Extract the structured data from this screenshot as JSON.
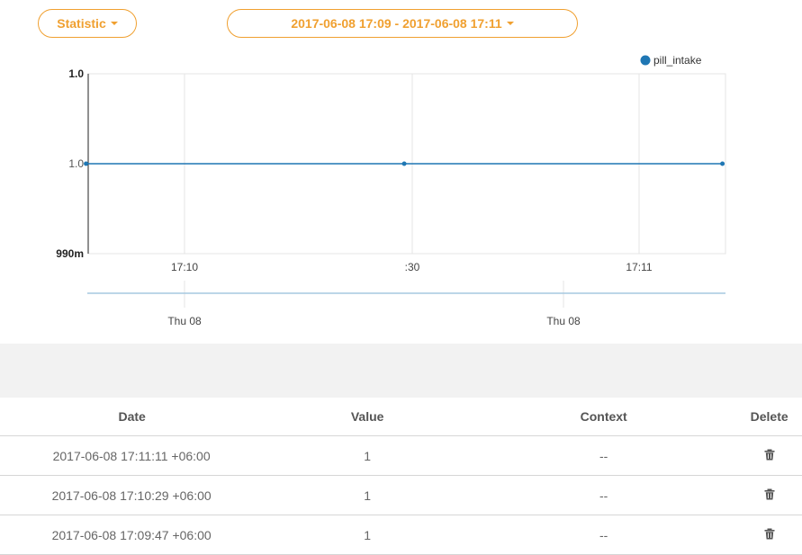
{
  "controls": {
    "statistic_label": "Statistic",
    "range_label": "2017-06-08 17:09 - 2017-06-08 17:11"
  },
  "chart_data": {
    "type": "line",
    "legend": {
      "label": "pill_intake",
      "placement": "top-right"
    },
    "series": [
      {
        "name": "pill_intake",
        "color": "#1f77b4",
        "x": [
          "2017-06-08 17:09:47",
          "2017-06-08 17:10:29",
          "2017-06-08 17:11:11"
        ],
        "values": [
          1,
          1,
          1
        ]
      }
    ],
    "y_ticks": [
      "1.0",
      "1.0",
      "990m"
    ],
    "x_ticks": [
      "17:10",
      ":30",
      "17:11"
    ],
    "navigator_ticks": [
      "Thu 08",
      "Thu 08"
    ],
    "grid": true
  },
  "table": {
    "headers": {
      "date": "Date",
      "value": "Value",
      "context": "Context",
      "delete": "Delete"
    },
    "rows": [
      {
        "date": "2017-06-08 17:11:11 +06:00",
        "value": "1",
        "context": "--"
      },
      {
        "date": "2017-06-08 17:10:29 +06:00",
        "value": "1",
        "context": "--"
      },
      {
        "date": "2017-06-08 17:09:47 +06:00",
        "value": "1",
        "context": "--"
      }
    ]
  },
  "colors": {
    "accent": "#f0a030",
    "series": "#1f77b4",
    "navigator": "#a6c8e0"
  }
}
